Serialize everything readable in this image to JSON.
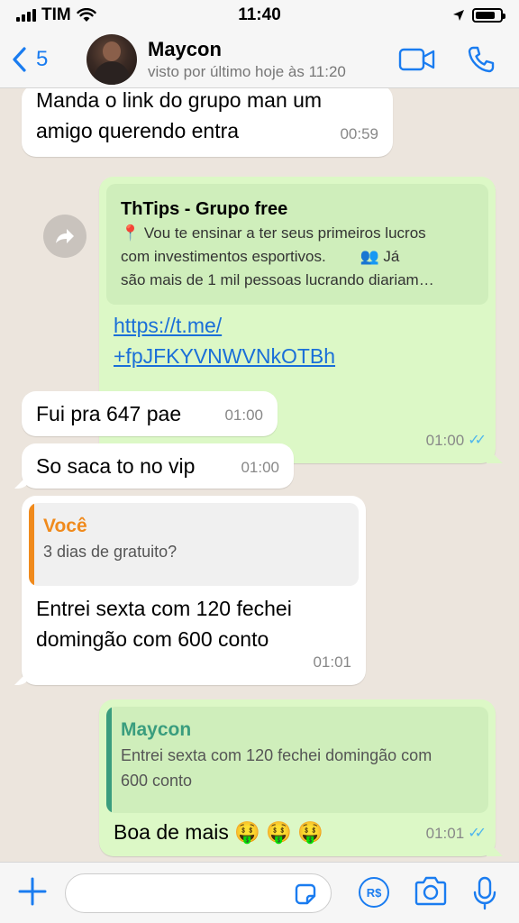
{
  "status_bar": {
    "carrier": "TIM",
    "time": "11:40"
  },
  "header": {
    "back_count": "5",
    "contact_name": "Maycon",
    "last_seen": "visto por último hoje às 11:20"
  },
  "messages": [
    {
      "direction": "in",
      "text_line1": "Manda o link do grupo man um",
      "text_line2": "amigo querendo entra",
      "time": "00:59"
    },
    {
      "direction": "out",
      "preview_title": "ThTips - Grupo free",
      "preview_line1": "📍 Vou te ensinar a ter seus primeiros lucros",
      "preview_line2": "com investimentos esportivos.        👥 Já",
      "preview_line3": "são mais de 1 mil pessoas lucrando diariam…",
      "link_line1": "https://t.me/",
      "link_line2": "+fpJFKYVNWVNkOTBh",
      "time": "01:00"
    },
    {
      "direction": "in",
      "text": "Fui pra 647 pae",
      "time": "01:00"
    },
    {
      "direction": "in",
      "text": "So saca to no vip",
      "time": "01:00"
    },
    {
      "direction": "in",
      "quote_author": "Você",
      "quote_text": "3 dias de gratuito?",
      "text_line1": "Entrei sexta com 120 fechei",
      "text_line2": "domingão com 600 conto",
      "time": "01:01"
    },
    {
      "direction": "out",
      "quote_author": "Maycon",
      "quote_line1": "Entrei sexta com 120 fechei domingão com",
      "quote_line2": "600 conto",
      "text": "Boa de mais 🤑 🤑 🤑",
      "time": "01:01"
    }
  ],
  "input_bar": {
    "payment_label": "R$"
  },
  "colors": {
    "accent": "#1a7cf0",
    "outgoing_bubble": "#dcf8c6",
    "incoming_bubble": "#ffffff",
    "chat_background": "#ece5dd",
    "read_ticks": "#4fb6ec",
    "quote_you": "#f08a1c",
    "quote_contact": "#3a9d7e"
  },
  "icons": [
    "signal-icon",
    "wifi-icon",
    "location-icon",
    "battery-icon",
    "back-chevron-icon",
    "video-call-icon",
    "phone-icon",
    "forward-icon",
    "add-icon",
    "sticker-icon",
    "payment-icon",
    "camera-icon",
    "microphone-icon"
  ]
}
